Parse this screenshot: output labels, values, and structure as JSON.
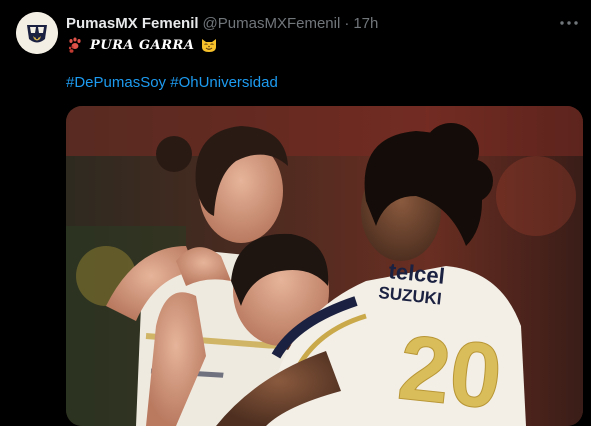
{
  "tweet": {
    "display_name": "PumasMX Femenil",
    "handle": "@PumasMXFemenil",
    "separator": "·",
    "time": "17h",
    "text_main": "PURA GARRA",
    "hashtags": [
      "#DePumasSoy",
      "#OhUniversidad"
    ]
  },
  "photo": {
    "jersey_sponsor": "telcel",
    "jersey_brand": "SUZUKI",
    "jersey_number": "20"
  },
  "colors": {
    "background": "#000000",
    "link": "#1d9bf0",
    "muted": "#71767b",
    "jersey_gold": "#c9a94a",
    "jersey_navy": "#1b2140"
  },
  "icons": {
    "paw": "paw-prints-icon",
    "emoji": "cat-face-emoji-icon",
    "more": "more-horizontal-icon"
  }
}
